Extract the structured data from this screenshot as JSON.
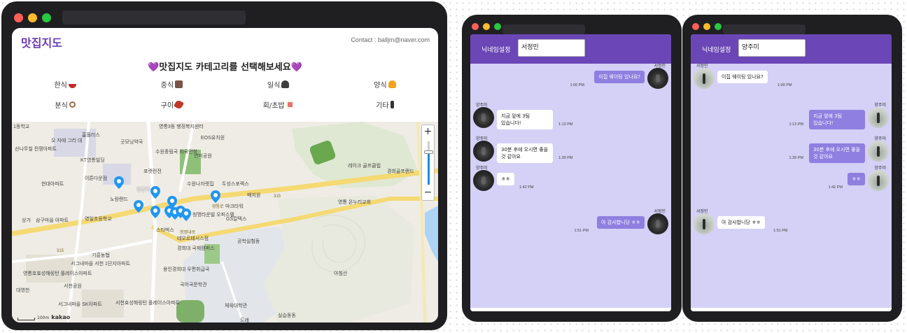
{
  "map_app": {
    "brand": "맛집지도",
    "contact": "Contact : balljm@naver.com",
    "headline": "💜맛집지도 카테고리를 선택해보세요💜",
    "categories": [
      {
        "label": "한식",
        "icon": "rice-bowl-icon"
      },
      {
        "label": "중식",
        "icon": "noodle-icon"
      },
      {
        "label": "일식",
        "icon": "sushi-icon"
      },
      {
        "label": "양식",
        "icon": "burger-icon"
      },
      {
        "label": "분식",
        "icon": "magnifier-icon"
      },
      {
        "label": "구이",
        "icon": "meat-icon"
      },
      {
        "label": "회/초밥",
        "icon": "sushi-roll-icon"
      },
      {
        "label": "기타",
        "icon": "bottle-icon"
      }
    ],
    "map_labels": [
      "1동학교",
      "홈플러스",
      "영통3동 행정복지센터",
      "EOS유치원",
      "선나무칠 전쟁아파트",
      "오 자에 그리 대",
      "굿모닝약국",
      "수원중림국 외국인청",
      "연미공원",
      "KT영통빌딩",
      "포랫런전",
      "이튼다운점",
      "현대아파트",
      "영통역",
      "수원나자렛집",
      "두성스포렉스",
      "레이크 골프클럽",
      "경희골프랜드",
      "노랑랜드",
      "매지원",
      "마크타워",
      "영통 온누리교회",
      "상가",
      "삼구마을 아파트",
      "영일초등학교",
      "청명타운빌 오피스텔",
      "GS칼텍스",
      "스타벅스",
      "테오르테시스점",
      "경희대 국제캠퍼스",
      "공학실험동",
      "기흥농협",
      "서그내마을 서천 1단지아파트",
      "용인경희대 우편취급국",
      "영통호효성해링턴 플레이스아파트",
      "서천공원",
      "국어국문학관",
      "아침산",
      "서그내마을 SK아파트",
      "서천효성해링턴 플레이스아파트",
      "체육대학관",
      "실습동동",
      "도레",
      "대영천",
      "315",
      "315",
      "청명대로",
      "영통로"
    ],
    "zoom_in": "+",
    "zoom_out": "−",
    "zoom_level": 0.35,
    "scale_label": "100m",
    "map_provider": "kakao"
  },
  "chats": [
    {
      "nickname_label": "닉네임설정",
      "nickname_value": "서정민",
      "messages": [
        {
          "sender": "서정민",
          "text": "이집 웨이팅 있나요?",
          "time": "1:00 PM",
          "side": "out"
        },
        {
          "sender": "양주미",
          "text": "지금 앞에 3팀 있습니다!",
          "time": "1:13 PM",
          "side": "in"
        },
        {
          "sender": "양주미",
          "text": "30분 후에 오시면 좋을 것 같아요",
          "time": "1:39 PM",
          "side": "in"
        },
        {
          "sender": "양주미",
          "text": "ㅎㅎ",
          "time": "1:42 PM",
          "side": "in"
        },
        {
          "sender": "서정민",
          "text": "아 감사합니당 ㅎㅎ",
          "time": "1:51 PM",
          "side": "out"
        }
      ]
    },
    {
      "nickname_label": "닉네임설정",
      "nickname_value": "양주미",
      "messages": [
        {
          "sender": "서정민",
          "text": "이집 웨이팅 있나요?",
          "time": "1:00 PM",
          "side": "in"
        },
        {
          "sender": "양주미",
          "text": "지금 앞에 3팀 있습니다!",
          "time": "1:13 PM",
          "side": "out"
        },
        {
          "sender": "양주미",
          "text": "30분 후에 오시면 좋을 것 같아요",
          "time": "1:39 PM",
          "side": "out"
        },
        {
          "sender": "양주미",
          "text": "ㅎㅎ",
          "time": "1:42 PM",
          "side": "out"
        },
        {
          "sender": "서정민",
          "text": "아 감사합니당 ㅎㅎ",
          "time": "1:51 PM",
          "side": "in"
        }
      ]
    }
  ],
  "colors": {
    "brand_purple": "#6a3cb4",
    "chat_header": "#6b46b6",
    "chat_bg": "#d4d0f6",
    "bubble_out": "#8f7fe0",
    "map_pin": "#2196f3"
  }
}
